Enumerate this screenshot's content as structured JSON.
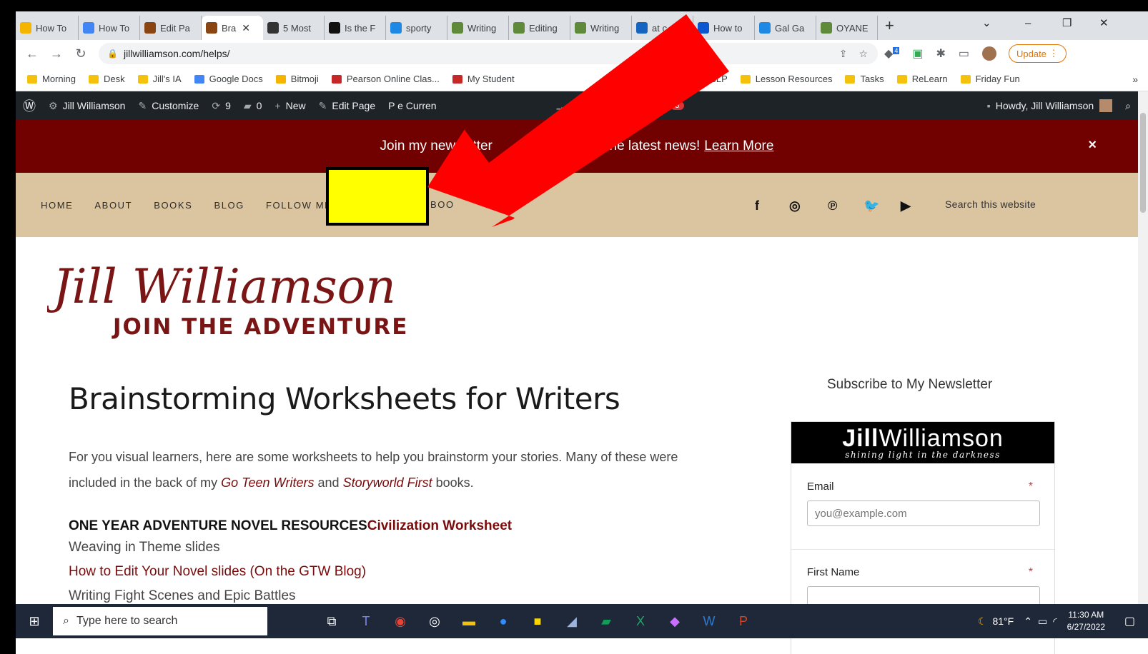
{
  "browser": {
    "tabs": [
      {
        "title": "How To",
        "color": "#f4b400"
      },
      {
        "title": "How To",
        "color": "#4285f4"
      },
      {
        "title": "Edit Pa",
        "color": "#8b4513"
      },
      {
        "title": "Bra",
        "color": "#8b4513",
        "active": true
      },
      {
        "title": "5 Most",
        "color": "#333333"
      },
      {
        "title": "Is the F",
        "color": "#111111"
      },
      {
        "title": "sporty",
        "color": "#1e88e5"
      },
      {
        "title": "Writing",
        "color": "#5f8a3a"
      },
      {
        "title": "Editing",
        "color": "#5f8a3a"
      },
      {
        "title": "Writing",
        "color": "#5f8a3a"
      },
      {
        "title": "at c",
        "color": "#1565c0"
      },
      {
        "title": "How to",
        "color": "#0b57d0"
      },
      {
        "title": "Gal Ga",
        "color": "#1e88e5"
      },
      {
        "title": "OYANE",
        "color": "#5f8a3a"
      }
    ],
    "new_tab": "+",
    "tab_close": "✕",
    "url": "jillwilliamson.com/helps/",
    "update_label": "Update",
    "extension_badge": "4",
    "bookmarks": [
      {
        "label": "Morning",
        "color": "#f4c20d"
      },
      {
        "label": "Desk",
        "color": "#f4c20d"
      },
      {
        "label": "Jill's IA",
        "color": "#f4c20d"
      },
      {
        "label": "Google Docs",
        "color": "#4285f4"
      },
      {
        "label": "Bitmoji",
        "color": "#f4b400"
      },
      {
        "label": "Pearson Online Clas...",
        "color": "#c62828"
      },
      {
        "label": "My Student",
        "color": "#c62828"
      },
      {
        "label": "A/WSLP",
        "color": "#f4c20d"
      },
      {
        "label": "Lesson Resources",
        "color": "#f4c20d"
      },
      {
        "label": "Tasks",
        "color": "#f4c20d"
      },
      {
        "label": "ReLearn",
        "color": "#f4c20d"
      },
      {
        "label": "Friday Fun",
        "color": "#f4c20d"
      }
    ],
    "bookmarks_more": "»"
  },
  "wp_admin": {
    "site_name": "Jill Williamson",
    "customize": "Customize",
    "updates": "9",
    "comments": "0",
    "new": "New",
    "edit_page": "Edit Page",
    "purge": "P   e Curren",
    "wpforms": "WPForms",
    "wpforms_count": "3",
    "howdy": "Howdy, Jill Williamson"
  },
  "site": {
    "promo_text": "Join my newsletter                              the latest news!",
    "promo_link": "Learn More",
    "promo_close": "×",
    "nav": [
      "HOME",
      "ABOUT",
      "BOOKS",
      "BLOG",
      "FOLLOW ME"
    ],
    "nav_after_box": "BOO",
    "search_label": "Search this website",
    "logo_script": "Jill Williamson",
    "logo_tagline": "JOIN THE ADVENTURE",
    "page_title": "Brainstorming Worksheets for Writers",
    "intro_pre": "For you visual learners, here are some worksheets to help you brainstorm your stories. Many of these were included in the back of my ",
    "intro_book1": "Go Teen Writers",
    "intro_mid": " and ",
    "intro_book2": "Storyworld First",
    "intro_post": " books.",
    "resources_head": "ONE YEAR ADVENTURE NOVEL RESOURCES",
    "resources_head_link": "Civilization Worksheet",
    "resource_plain": "Weaving in Theme slides",
    "resource_link": "How to Edit Your Novel slides (On the GTW Blog)",
    "resource_cut": "Writing Fight Scenes and Epic Battles"
  },
  "sidebar": {
    "subscribe_title": "Subscribe to My Newsletter",
    "banner_name_bold": "Jill",
    "banner_name_light": "Williamson",
    "banner_tagline": "shining light in the darkness",
    "email_label": "Email",
    "email_placeholder": "you@example.com",
    "first_name_label": "First Name",
    "required_mark": "*"
  },
  "taskbar": {
    "search_placeholder": "Type here to search",
    "temperature": "81°F",
    "time": "11:30 AM",
    "date": "6/27/2022"
  },
  "annotation": {
    "arrow_color": "#ff0000",
    "highlight_color": "#ffff00"
  }
}
